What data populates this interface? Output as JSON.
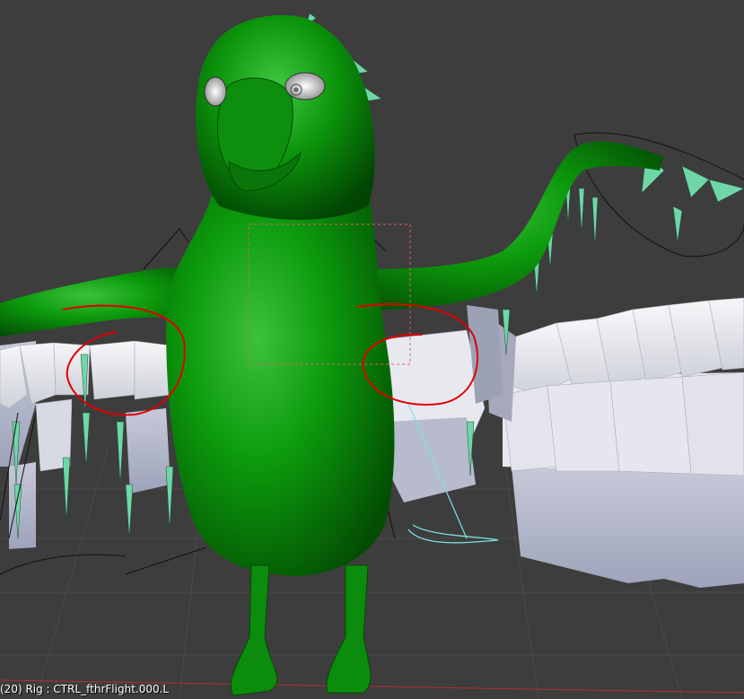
{
  "viewport": {
    "status_text": "(20) Rig : CTRL_fthrFlight.000.L",
    "background": "#3d3d3d",
    "grid_color": "#4a4a4a",
    "character_color": "#0a8a0a",
    "feather_color": "#e6e6ec",
    "feather_shadow": "#b8bccc",
    "bone_color": "#6fd6a8",
    "annotation_color": "#e00000",
    "selection_box_color": "#e06060"
  }
}
